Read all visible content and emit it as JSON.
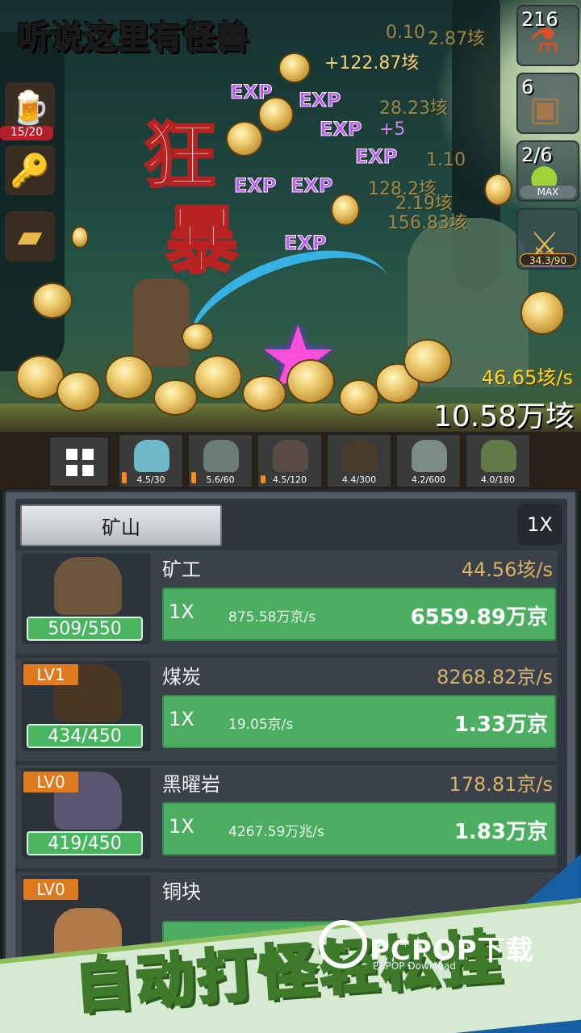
{
  "game": {
    "title": "听说这里有怪兽",
    "total_currency": "10.58万垓",
    "floating_damage": [
      "+122.87垓",
      "0.10",
      "2.87垓",
      "28.23垓",
      "+5",
      "1.10",
      "128.2垓",
      "2.19垓",
      "156.83垓",
      "46.65垓/s"
    ],
    "exp_label": "EXP",
    "banner_line1": "狂",
    "banner_line2": "暴"
  },
  "left_bar": {
    "items": [
      {
        "icon": "beer-mug-icon",
        "label": "15/20"
      },
      {
        "icon": "treasure-key-icon",
        "label": ""
      },
      {
        "icon": "gold-bar-icon",
        "label": ""
      }
    ]
  },
  "right_bar": {
    "items": [
      {
        "icon": "potion-icon",
        "count": "216",
        "tag": ""
      },
      {
        "icon": "chest-icon",
        "count": "6",
        "tag": ""
      },
      {
        "icon": "slime-pet-icon",
        "count": "2/6",
        "tag": "MAX"
      },
      {
        "icon": "sword-icon",
        "count": "",
        "tag": "34.3/90"
      }
    ]
  },
  "monster_bar": {
    "slots": [
      {
        "name": "slime",
        "stat": "4.5/30",
        "color": "#6fb8c8"
      },
      {
        "name": "zombie",
        "stat": "5.6/60",
        "color": "#6b7c74"
      },
      {
        "name": "bat",
        "stat": "4.5/120",
        "color": "#5a4a44"
      },
      {
        "name": "spider",
        "stat": "4.4/300",
        "color": "#4a3a2a"
      },
      {
        "name": "ghoul",
        "stat": "4.2/600",
        "color": "#7c8a88"
      },
      {
        "name": "goblin",
        "stat": "4.0/180",
        "color": "#5f7a44"
      }
    ]
  },
  "panel": {
    "tab_label": "矿山",
    "speed_label": "1X",
    "rows": [
      {
        "lv": "",
        "name": "矿工",
        "rate": "44.56垓/s",
        "count": "509/550",
        "mult": "1X",
        "sub": "875.58万京/s",
        "cost": "6559.89万京",
        "art_color": "#6b553c"
      },
      {
        "lv": "LV1",
        "name": "煤炭",
        "rate": "8268.82京/s",
        "count": "434/450",
        "mult": "1X",
        "sub": "19.05京/s",
        "cost": "1.33万京",
        "art_color": "#4a3624"
      },
      {
        "lv": "LV0",
        "name": "黑曜岩",
        "rate": "178.81京/s",
        "count": "419/450",
        "mult": "1X",
        "sub": "4267.59万兆/s",
        "cost": "1.83万京",
        "art_color": "#5a5670"
      },
      {
        "lv": "LV0",
        "name": "铜块",
        "rate": "",
        "count": "",
        "mult": "",
        "sub": "",
        "cost": "",
        "art_color": "#b07a48"
      }
    ]
  },
  "promo": {
    "text": "自动打怪轻松挂",
    "watermark": "PCPOP下载",
    "watermark_sub": "PCPOP Download"
  }
}
